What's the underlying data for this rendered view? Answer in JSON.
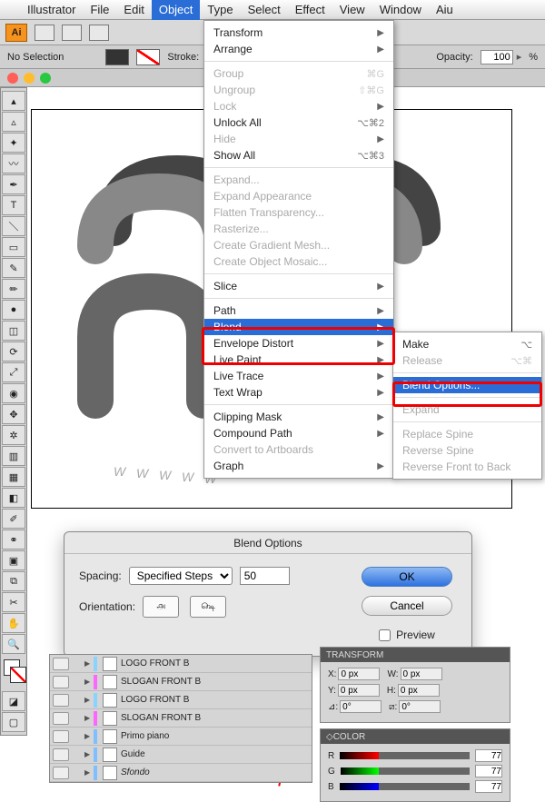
{
  "menubar": {
    "items": [
      "Illustrator",
      "File",
      "Edit",
      "Object",
      "Type",
      "Select",
      "Effect",
      "View",
      "Window",
      "Aiu"
    ],
    "open_index": 3
  },
  "options_bar": {
    "selection": "No Selection",
    "stroke_label": "Stroke:",
    "opacity_label": "Opacity:",
    "opacity_value": "100",
    "opacity_unit": "%"
  },
  "object_menu": {
    "groups": [
      [
        {
          "label": "Transform",
          "arrow": true
        },
        {
          "label": "Arrange",
          "arrow": true
        }
      ],
      [
        {
          "label": "Group",
          "shortcut": "⌘G",
          "disabled": true
        },
        {
          "label": "Ungroup",
          "shortcut": "⇧⌘G",
          "disabled": true
        },
        {
          "label": "Lock",
          "arrow": true,
          "disabled": true
        },
        {
          "label": "Unlock All",
          "shortcut": "⌥⌘2"
        },
        {
          "label": "Hide",
          "arrow": true,
          "disabled": true
        },
        {
          "label": "Show All",
          "shortcut": "⌥⌘3"
        }
      ],
      [
        {
          "label": "Expand...",
          "disabled": true
        },
        {
          "label": "Expand Appearance",
          "disabled": true
        },
        {
          "label": "Flatten Transparency...",
          "disabled": true
        },
        {
          "label": "Rasterize...",
          "disabled": true
        },
        {
          "label": "Create Gradient Mesh...",
          "disabled": true
        },
        {
          "label": "Create Object Mosaic...",
          "disabled": true
        }
      ],
      [
        {
          "label": "Slice",
          "arrow": true
        }
      ],
      [
        {
          "label": "Path",
          "arrow": true
        },
        {
          "label": "Blend",
          "arrow": true,
          "selected": true
        },
        {
          "label": "Envelope Distort",
          "arrow": true
        },
        {
          "label": "Live Paint",
          "arrow": true
        },
        {
          "label": "Live Trace",
          "arrow": true
        },
        {
          "label": "Text Wrap",
          "arrow": true
        }
      ],
      [
        {
          "label": "Clipping Mask",
          "arrow": true
        },
        {
          "label": "Compound Path",
          "arrow": true
        },
        {
          "label": "Convert to Artboards",
          "disabled": true
        },
        {
          "label": "Graph",
          "arrow": true
        }
      ]
    ]
  },
  "blend_submenu": {
    "groups": [
      [
        {
          "label": "Make",
          "shortcut": "⌥"
        },
        {
          "label": "Release",
          "shortcut": "⌥⌘",
          "disabled": true
        }
      ],
      [
        {
          "label": "Blend Options...",
          "selected": true
        }
      ],
      [
        {
          "label": "Expand",
          "disabled": true
        }
      ],
      [
        {
          "label": "Replace Spine",
          "disabled": true
        },
        {
          "label": "Reverse Spine",
          "disabled": true
        },
        {
          "label": "Reverse Front to Back",
          "disabled": true
        }
      ]
    ]
  },
  "dialog": {
    "title": "Blend Options",
    "spacing_label": "Spacing:",
    "spacing_mode": "Specified Steps",
    "spacing_value": "50",
    "orientation_label": "Orientation:",
    "ok": "OK",
    "cancel": "Cancel",
    "preview": "Preview"
  },
  "layers": {
    "rows": [
      {
        "name": "LOGO FRONT B",
        "color": "#8ad3ff"
      },
      {
        "name": "SLOGAN FRONT B",
        "color": "#ff66ff"
      },
      {
        "name": "LOGO FRONT B",
        "color": "#8ad3ff"
      },
      {
        "name": "SLOGAN FRONT B",
        "color": "#ff66ff"
      },
      {
        "name": "Primo piano",
        "color": "#7fbfff"
      },
      {
        "name": "Guide",
        "color": "#7fbfff"
      },
      {
        "name": "Sfondo",
        "italic": true,
        "color": "#7fbfff"
      }
    ]
  },
  "transform": {
    "title": "TRANSFORM",
    "x": "0 px",
    "y": "0 px",
    "w": "0 px",
    "h": "0 px",
    "angle": "0°",
    "shear": "0°"
  },
  "color": {
    "title": "COLOR",
    "r": "77",
    "g": "77",
    "b": "77"
  },
  "canvas_letters": [
    "W",
    "W",
    "W",
    "W",
    "W"
  ]
}
